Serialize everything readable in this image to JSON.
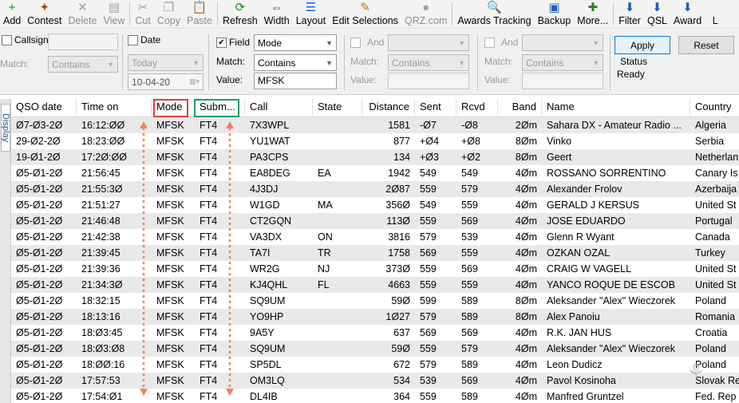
{
  "toolbar": {
    "items": [
      {
        "label": "Add",
        "icon": "add-icon",
        "glyph": "+",
        "color": "#1a8a1a",
        "enabled": true
      },
      {
        "label": "Contest",
        "icon": "contest-icon",
        "glyph": "✦",
        "color": "#b14a00",
        "enabled": true
      },
      {
        "label": "Delete",
        "icon": "delete-icon",
        "glyph": "✕",
        "color": "#a0a0a0",
        "enabled": false
      },
      {
        "label": "View",
        "icon": "view-icon",
        "glyph": "▤",
        "color": "#a0a0a0",
        "enabled": false
      },
      {
        "sep": true
      },
      {
        "label": "Cut",
        "icon": "cut-icon",
        "glyph": "✂",
        "color": "#a0a0a0",
        "enabled": false
      },
      {
        "label": "Copy",
        "icon": "copy-icon",
        "glyph": "❐",
        "color": "#a0a0a0",
        "enabled": false
      },
      {
        "label": "Paste",
        "icon": "paste-icon",
        "glyph": "📋",
        "color": "#a0a0a0",
        "enabled": false
      },
      {
        "sep": true
      },
      {
        "label": "Refresh",
        "icon": "refresh-icon",
        "glyph": "⟳",
        "color": "#1a8a1a",
        "enabled": true
      },
      {
        "label": "Width",
        "icon": "width-icon",
        "glyph": "⇔",
        "color": "#1d5fbf",
        "enabled": true
      },
      {
        "label": "Layout",
        "icon": "layout-icon",
        "glyph": "☰",
        "color": "#1d5fbf",
        "enabled": true
      },
      {
        "label": "Edit Selections",
        "icon": "edit-selections-icon",
        "glyph": "✎",
        "color": "#c07000",
        "enabled": true
      },
      {
        "label": "QRZ.com",
        "icon": "qrz-icon",
        "glyph": "●",
        "color": "#a0a0a0",
        "enabled": false
      },
      {
        "sep": true
      },
      {
        "label": "Awards Tracking",
        "icon": "awards-tracking-icon",
        "glyph": "🔍",
        "color": "#c07000",
        "enabled": true
      },
      {
        "label": "Backup",
        "icon": "backup-icon",
        "glyph": "▣",
        "color": "#1d5fbf",
        "enabled": true
      },
      {
        "label": "More...",
        "icon": "more-icon",
        "glyph": "✚",
        "color": "#1a8a1a",
        "enabled": true
      },
      {
        "sep": true
      },
      {
        "label": "Filter",
        "icon": "filter-icon",
        "glyph": "⬇",
        "color": "#1d5fbf",
        "enabled": true
      },
      {
        "label": "QSL",
        "icon": "qsl-icon",
        "glyph": "⬇",
        "color": "#1d5fbf",
        "enabled": true
      },
      {
        "label": "Award",
        "icon": "award-icon",
        "glyph": "⬇",
        "color": "#1d5fbf",
        "enabled": true
      },
      {
        "label": "L",
        "icon": "overflow-icon",
        "glyph": "",
        "color": "#a0a0a0",
        "enabled": true
      }
    ]
  },
  "filter": {
    "callsign": {
      "label": "Callsign",
      "checked": false,
      "match_label": "Match:",
      "match_value": "Contains"
    },
    "date": {
      "label": "Date",
      "checked": false,
      "preset": "Today",
      "value": "10-04-20"
    },
    "field": {
      "label": "Field",
      "checked": true,
      "field_value": "Mode",
      "match_label": "Match:",
      "match_value": "Contains",
      "value_label": "Value:",
      "value": "MFSK"
    },
    "and1": {
      "label": "And",
      "checked": false,
      "match_label": "Match:",
      "match_value": "Contains",
      "value_label": "Value:"
    },
    "and2": {
      "label": "And",
      "checked": false,
      "match_label": "Match:",
      "match_value": "Contains",
      "value_label": "Value:"
    },
    "apply_label": "Apply",
    "reset_label": "Reset",
    "status_label": "Status",
    "status_value": "Ready"
  },
  "sidetab": {
    "label": "Display"
  },
  "grid": {
    "columns": [
      "QSO date",
      "Time on",
      "Mode",
      "Subm...",
      "Call",
      "State",
      "Distance",
      "Sent",
      "Rcvd",
      "Band",
      "Name",
      "Country"
    ],
    "rows": [
      [
        "Ø7-Ø3-2Ø",
        "16:12:ØØ",
        "MFSK",
        "FT4",
        "7X3WPL",
        "",
        "1581",
        "-Ø7",
        "-Ø8",
        "2Øm",
        "Sahara DX - Amateur Radio ...",
        "Algeria"
      ],
      [
        "29-Ø2-2Ø",
        "18:23:ØØ",
        "MFSK",
        "FT4",
        "YU1WAT",
        "",
        "877",
        "+Ø4",
        "+Ø8",
        "8Øm",
        "Vinko",
        "Serbia"
      ],
      [
        "19-Ø1-2Ø",
        "17:2Ø:ØØ",
        "MFSK",
        "FT4",
        "PA3CPS",
        "",
        "134",
        "+Ø3",
        "+Ø2",
        "8Øm",
        "Geert",
        "Netherlan"
      ],
      [
        "Ø5-Ø1-2Ø",
        "21:56:45",
        "MFSK",
        "FT4",
        "EA8DEG",
        "EA",
        "1942",
        "549",
        "549",
        "4Øm",
        "ROSSANO SORRENTINO",
        "Canary Is"
      ],
      [
        "Ø5-Ø1-2Ø",
        "21:55:3Ø",
        "MFSK",
        "FT4",
        "4J3DJ",
        "",
        "2Ø87",
        "559",
        "579",
        "4Øm",
        "Alexander Frolov",
        "Azerbaija"
      ],
      [
        "Ø5-Ø1-2Ø",
        "21:51:27",
        "MFSK",
        "FT4",
        "W1GD",
        "MA",
        "356Ø",
        "549",
        "559",
        "4Øm",
        "GERALD J KERSUS",
        "United St"
      ],
      [
        "Ø5-Ø1-2Ø",
        "21:46:48",
        "MFSK",
        "FT4",
        "CT2GQN",
        "",
        "113Ø",
        "559",
        "569",
        "4Øm",
        "JOSE EDUARDO",
        "Portugal"
      ],
      [
        "Ø5-Ø1-2Ø",
        "21:42:38",
        "MFSK",
        "FT4",
        "VA3DX",
        "ON",
        "3816",
        "579",
        "539",
        "4Øm",
        "Glenn R Wyant",
        "Canada"
      ],
      [
        "Ø5-Ø1-2Ø",
        "21:39:45",
        "MFSK",
        "FT4",
        "TA7I",
        "TR",
        "1758",
        "569",
        "559",
        "4Øm",
        "OZKAN OZAL",
        "Turkey"
      ],
      [
        "Ø5-Ø1-2Ø",
        "21:39:36",
        "MFSK",
        "FT4",
        "WR2G",
        "NJ",
        "373Ø",
        "559",
        "569",
        "4Øm",
        "CRAIG W VAGELL",
        "United St"
      ],
      [
        "Ø5-Ø1-2Ø",
        "21:34:3Ø",
        "MFSK",
        "FT4",
        "KJ4QHL",
        "FL",
        "4663",
        "559",
        "559",
        "4Øm",
        "YANCO ROQUE DE ESCOB",
        "United St"
      ],
      [
        "Ø5-Ø1-2Ø",
        "18:32:15",
        "MFSK",
        "FT4",
        "SQ9UM",
        "",
        "59Ø",
        "599",
        "589",
        "8Øm",
        "Aleksander \"Alex\" Wieczorek",
        "Poland"
      ],
      [
        "Ø5-Ø1-2Ø",
        "18:13:16",
        "MFSK",
        "FT4",
        "YO9HP",
        "",
        "1Ø27",
        "579",
        "589",
        "8Øm",
        "Alex Panoiu",
        "Romania"
      ],
      [
        "Ø5-Ø1-2Ø",
        "18:Ø3:45",
        "MFSK",
        "FT4",
        "9A5Y",
        "",
        "637",
        "569",
        "569",
        "4Øm",
        "R.K. JAN HUS",
        "Croatia"
      ],
      [
        "Ø5-Ø1-2Ø",
        "18:Ø3:Ø8",
        "MFSK",
        "FT4",
        "SQ9UM",
        "",
        "59Ø",
        "559",
        "579",
        "4Øm",
        "Aleksander \"Alex\" Wieczorek",
        "Poland"
      ],
      [
        "Ø5-Ø1-2Ø",
        "18:ØØ:16",
        "MFSK",
        "FT4",
        "SP5DL",
        "",
        "672",
        "579",
        "589",
        "4Øm",
        "Leon Dudicz",
        "Poland"
      ],
      [
        "Ø5-Ø1-2Ø",
        "17:57:53",
        "MFSK",
        "FT4",
        "OM3LQ",
        "",
        "534",
        "539",
        "569",
        "4Øm",
        "Pavol Kosinoha",
        "Slovak Re"
      ],
      [
        "Ø5-Ø1-2Ø",
        "17:54:Ø1",
        "MFSK",
        "FT4",
        "DL4IB",
        "",
        "364",
        "559",
        "589",
        "4Øm",
        "Manfred Gruntzel",
        "Fed. Rep"
      ]
    ]
  },
  "annotations": {
    "mode_box_color": "#e23b3b",
    "subm_box_color": "#1b9e6f",
    "arrow_color": "#f0845a"
  }
}
